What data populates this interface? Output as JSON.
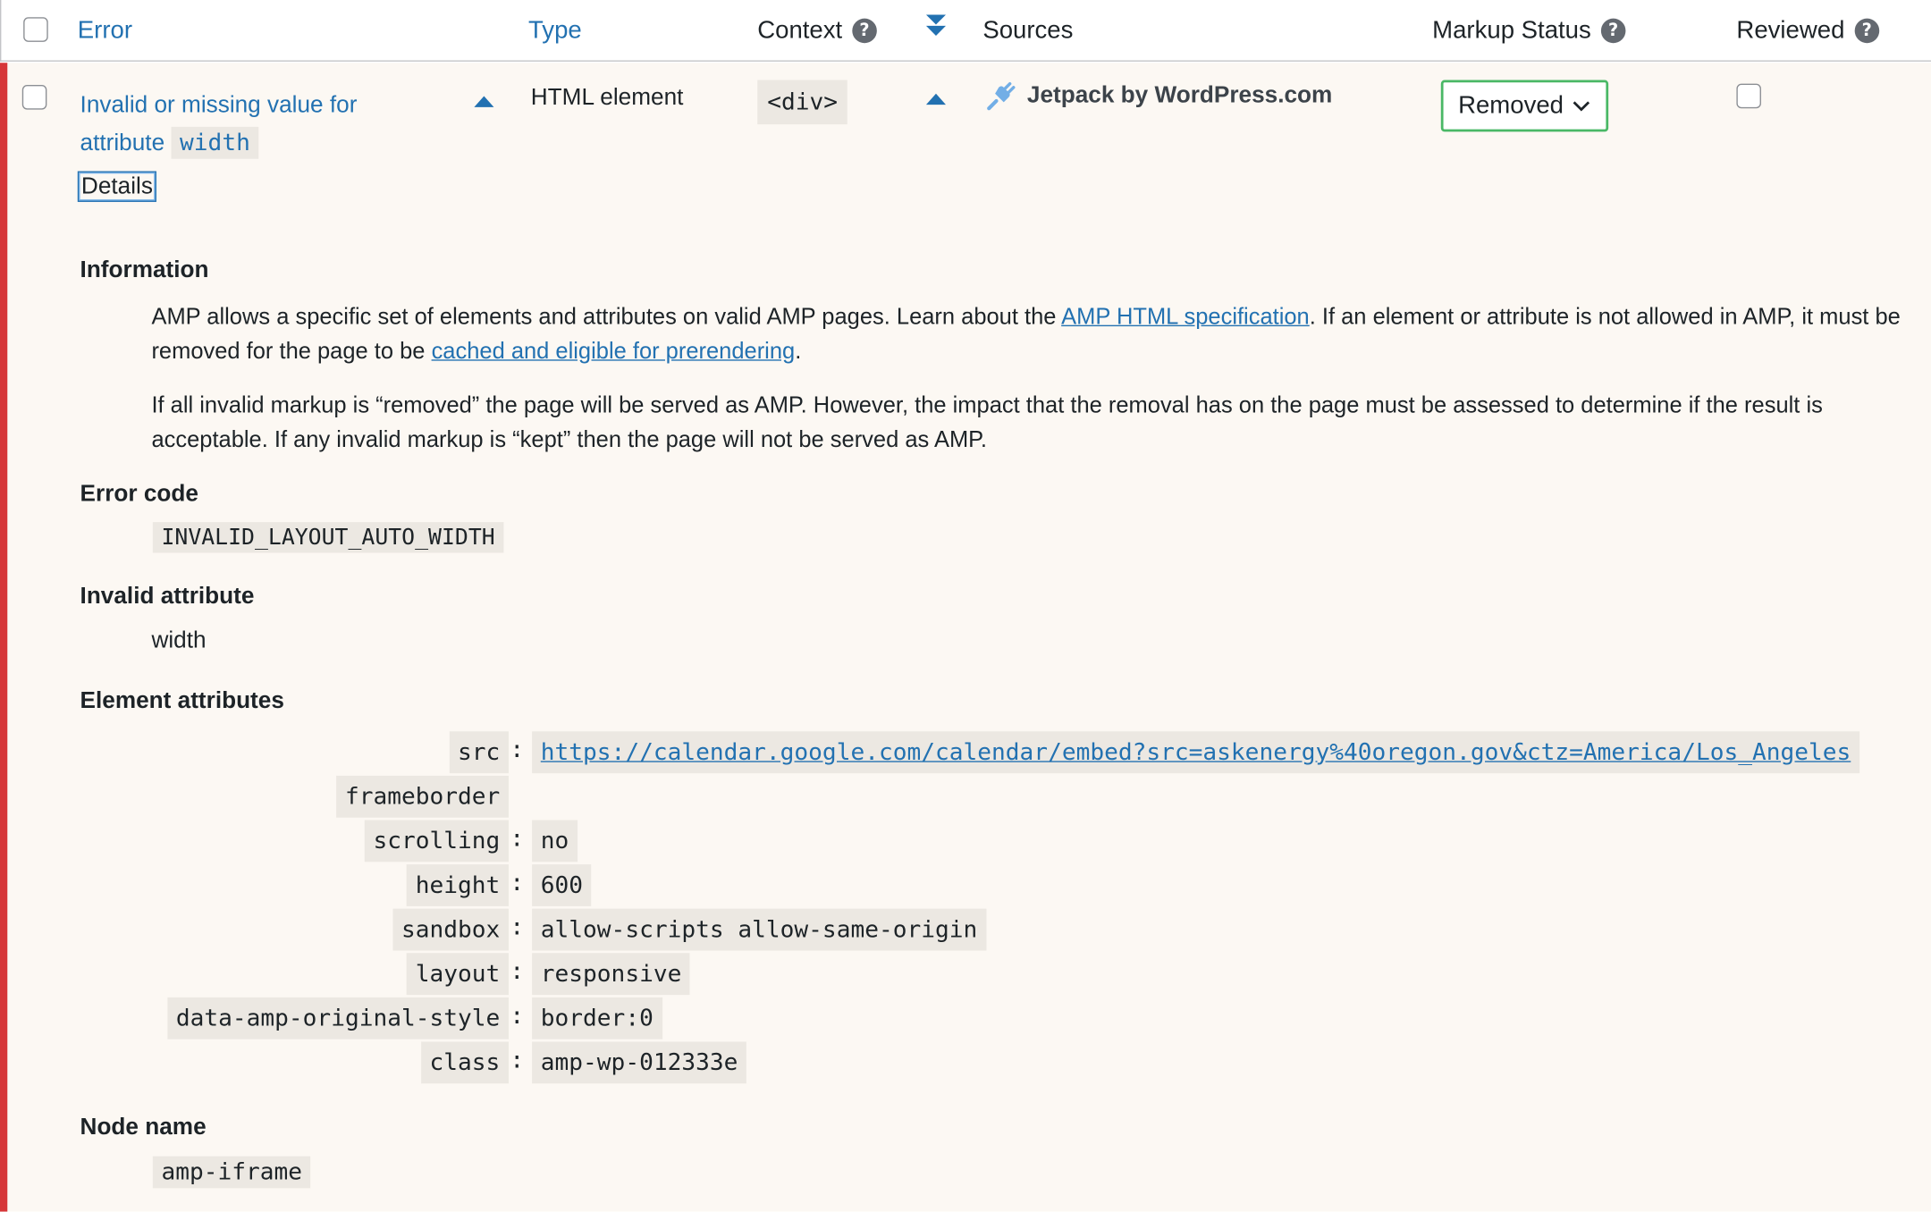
{
  "header": {
    "error_label": "Error",
    "type_label": "Type",
    "context_label": "Context",
    "sources_label": "Sources",
    "markup_status_label": "Markup Status",
    "reviewed_label": "Reviewed",
    "help_glyph": "?"
  },
  "row": {
    "error_text": "Invalid or missing value for attribute",
    "error_code_word": "width",
    "details_label": "Details",
    "type_value": "HTML element",
    "context_value": "<div>",
    "source_name": "Jetpack by WordPress.com",
    "status_value": "Removed",
    "accent_color": "#d63638"
  },
  "details": {
    "information_heading": "Information",
    "info_p1_a": "AMP allows a specific set of elements and attributes on valid AMP pages. Learn about the ",
    "info_p1_link1": "AMP HTML specification",
    "info_p1_b": ". If an element or attribute is not allowed in AMP, it must be removed for the page to be ",
    "info_p1_link2": "cached and eligible for prerendering",
    "info_p1_c": ".",
    "info_p2": "If all invalid markup is “removed” the page will be served as AMP. However, the impact that the removal has on the page must be assessed to determine if the result is acceptable. If any invalid markup is “kept” then the page will not be served as AMP.",
    "error_code_heading": "Error code",
    "error_code_value": "INVALID_LAYOUT_AUTO_WIDTH",
    "invalid_attribute_heading": "Invalid attribute",
    "invalid_attribute_value": "width",
    "element_attributes_heading": "Element attributes",
    "attributes": [
      {
        "key": "src",
        "colon": ":",
        "value": "https://calendar.google.com/calendar/embed?src=askenergy%40oregon.gov&ctz=America/Los_Angeles"
      },
      {
        "key": "frameborder",
        "colon": "",
        "value": ""
      },
      {
        "key": "scrolling",
        "colon": ":",
        "value": "no"
      },
      {
        "key": "height",
        "colon": ":",
        "value": "600"
      },
      {
        "key": "sandbox",
        "colon": ":",
        "value": "allow-scripts allow-same-origin"
      },
      {
        "key": "layout",
        "colon": ":",
        "value": "responsive"
      },
      {
        "key": "data-amp-original-style",
        "colon": ":",
        "value": "border:0"
      },
      {
        "key": "class",
        "colon": ":",
        "value": "amp-wp-012333e"
      }
    ],
    "node_name_heading": "Node name",
    "node_name_value": "amp-iframe"
  }
}
